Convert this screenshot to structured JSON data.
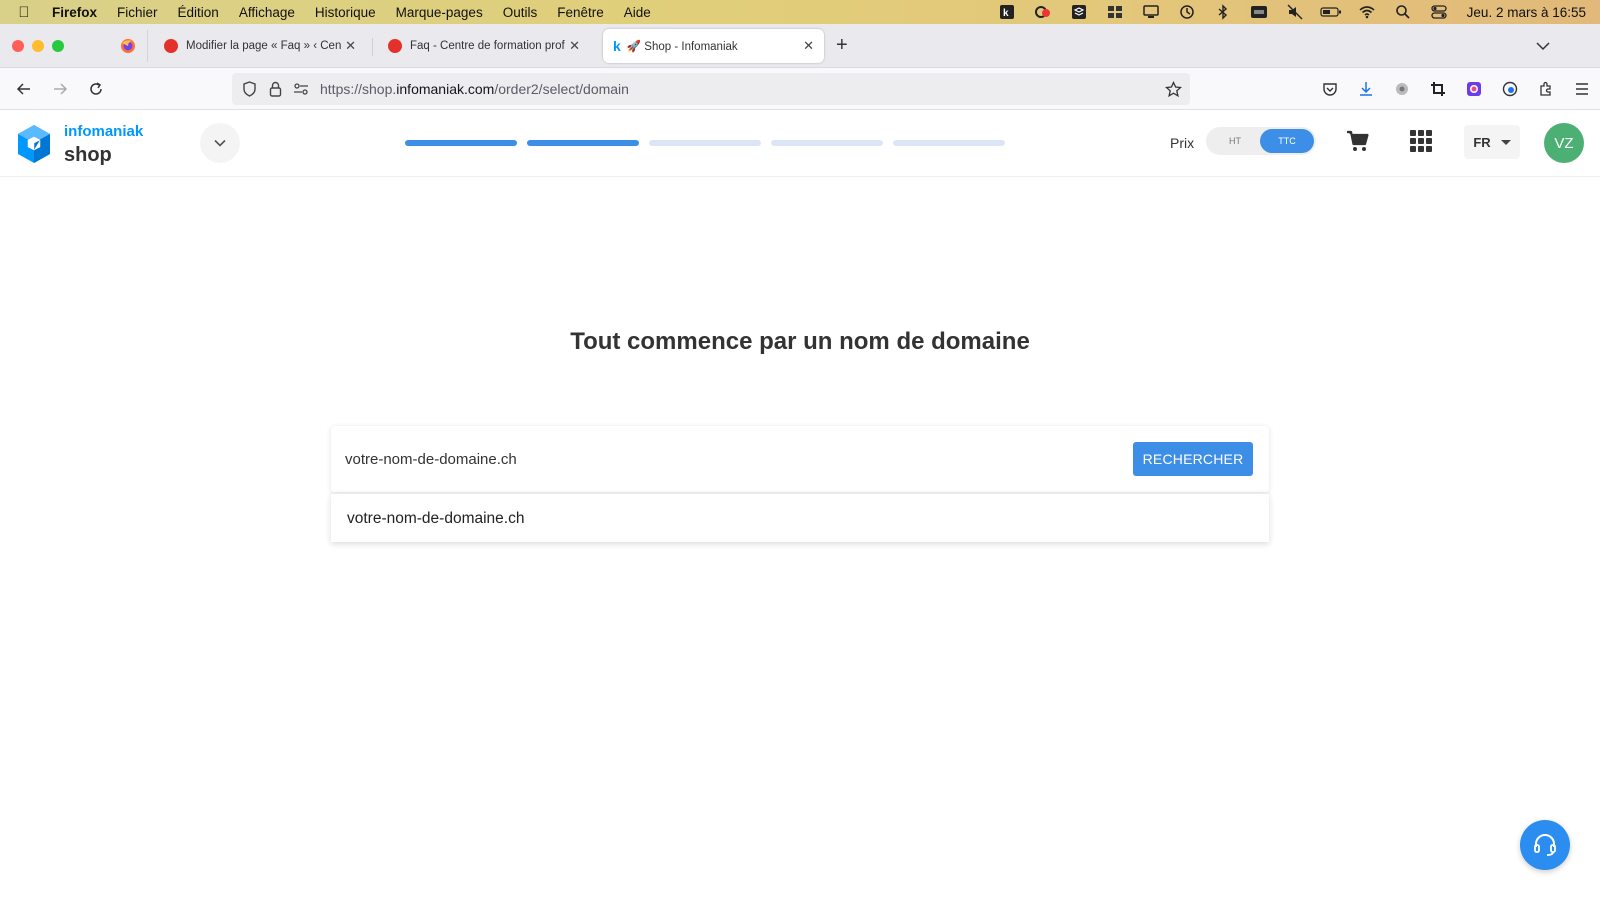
{
  "menubar": {
    "app_name": "Firefox",
    "items": [
      "Fichier",
      "Édition",
      "Affichage",
      "Historique",
      "Marque-pages",
      "Outils",
      "Fenêtre",
      "Aide"
    ],
    "clock": "Jeu. 2 mars à 16:55"
  },
  "tabs": [
    {
      "title": "Modifier la page « Faq » ‹ Centre",
      "favicon": "red-dot"
    },
    {
      "title": "Faq - Centre de formation profess",
      "favicon": "red-dot"
    },
    {
      "title": "🚀 Shop - Infomaniak",
      "favicon": "k",
      "active": true
    }
  ],
  "urlbar": {
    "prefix": "https://shop.",
    "host": "infomaniak.com",
    "path": "/order2/select/domain"
  },
  "site": {
    "brand_top": "infomaniak",
    "brand_bottom": "shop",
    "steps_total": 5,
    "steps_done": 2,
    "price_label": "Prix",
    "price_options": [
      "HT",
      "TTC"
    ],
    "price_selected": "TTC",
    "language": "FR",
    "avatar_initials": "VZ"
  },
  "main": {
    "headline": "Tout commence par un nom de domaine",
    "search_value": "votre-nom-de-domaine.ch",
    "search_button": "RECHERCHER",
    "suggestion": "votre-nom-de-domaine.ch"
  },
  "colors": {
    "accent": "#3d8ee6",
    "brand_blue": "#0098ff",
    "avatar_green": "#4caf74"
  }
}
